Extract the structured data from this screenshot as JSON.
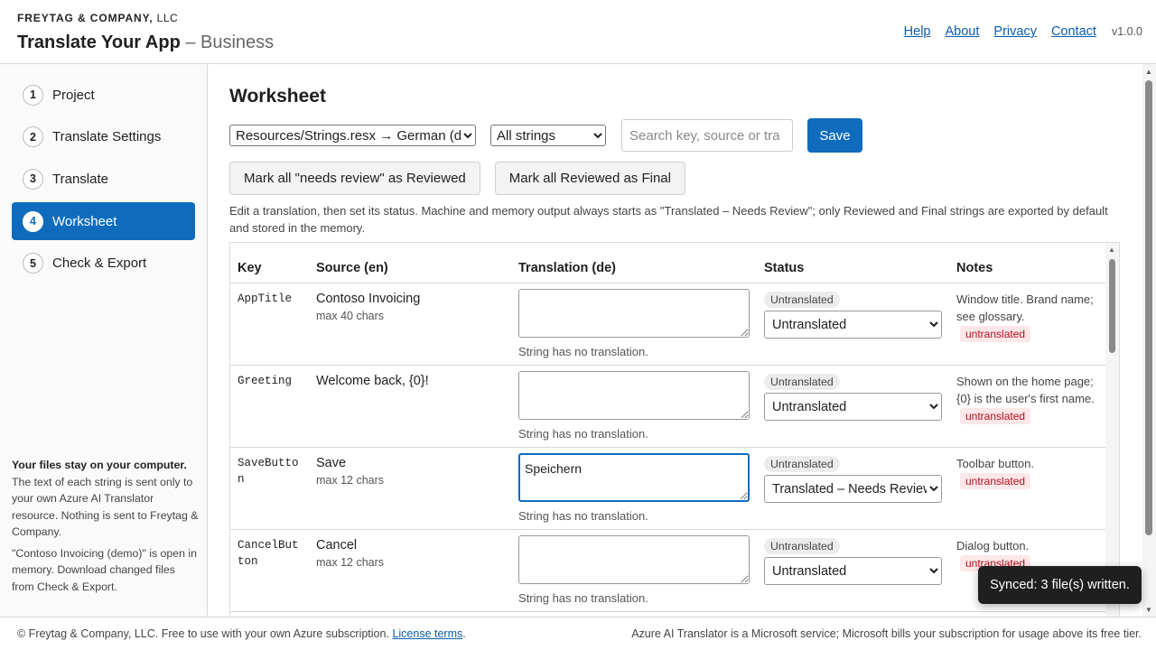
{
  "header": {
    "company": "FREYTAG & COMPANY,",
    "company_suffix": "LLC",
    "app_title": "Translate Your App",
    "edition": "– Business",
    "nav": [
      "Help",
      "About",
      "Privacy",
      "Contact"
    ],
    "version": "v1.0.0"
  },
  "sidebar": {
    "items": [
      {
        "num": "1",
        "label": "Project"
      },
      {
        "num": "2",
        "label": "Translate Settings"
      },
      {
        "num": "3",
        "label": "Translate"
      },
      {
        "num": "4",
        "label": "Worksheet"
      },
      {
        "num": "5",
        "label": "Check & Export"
      }
    ],
    "active_index": 3,
    "note_title": "Your files stay on your computer.",
    "note_body": "The text of each string is sent only to your own Azure AI Translator resource. Nothing is sent to Freytag & Company.",
    "note_project": "\"Contoso Invoicing (demo)\" is open in memory. Download changed files from Check & Export."
  },
  "main": {
    "title": "Worksheet",
    "file_select": "Resources/Strings.resx → German (de)",
    "filter_select": "All strings",
    "search_placeholder": "Search key, source or tra",
    "save_label": "Save",
    "mark_reviewed_label": "Mark all \"needs review\" as Reviewed",
    "mark_final_label": "Mark all Reviewed as Final",
    "help_text": "Edit a translation, then set its status. Machine and memory output always starts as \"Translated – Needs Review\"; only Reviewed and Final strings are exported by default and stored in the memory."
  },
  "table": {
    "headers": {
      "key": "Key",
      "source": "Source (en)",
      "translation": "Translation (de)",
      "status": "Status",
      "notes": "Notes"
    },
    "rows": [
      {
        "key": "AppTitle",
        "source": "Contoso Invoicing",
        "max": "max 40 chars",
        "translation": "",
        "no_translation": "String has no translation.",
        "badge": "Untranslated",
        "status": "Untranslated",
        "notes": "Window title. Brand name; see glossary.",
        "flag": "untranslated"
      },
      {
        "key": "Greeting",
        "source": "Welcome back, {0}!",
        "max": "",
        "translation": "",
        "no_translation": "String has no translation.",
        "badge": "Untranslated",
        "status": "Untranslated",
        "notes": "Shown on the home page; {0} is the user's first name.",
        "flag": "untranslated"
      },
      {
        "key": "SaveButton",
        "source": "Save",
        "max": "max 12 chars",
        "translation": "Speichern",
        "no_translation": "String has no translation.",
        "badge": "Untranslated",
        "status": "Translated – Needs Review",
        "notes": "Toolbar button.",
        "flag": "untranslated"
      },
      {
        "key": "CancelButton",
        "source": "Cancel",
        "max": "max 12 chars",
        "translation": "",
        "no_translation": "String has no translation.",
        "badge": "Untranslated",
        "status": "Untranslated",
        "notes": "Dialog button.",
        "flag": "untranslated"
      }
    ]
  },
  "footer": {
    "left": "© Freytag & Company, LLC. Free to use with your own Azure subscription.",
    "license_link": "License terms",
    "right": "Azure AI Translator is a Microsoft service; Microsoft bills your subscription for usage above its free tier."
  },
  "toast": "Synced: 3 file(s) written."
}
